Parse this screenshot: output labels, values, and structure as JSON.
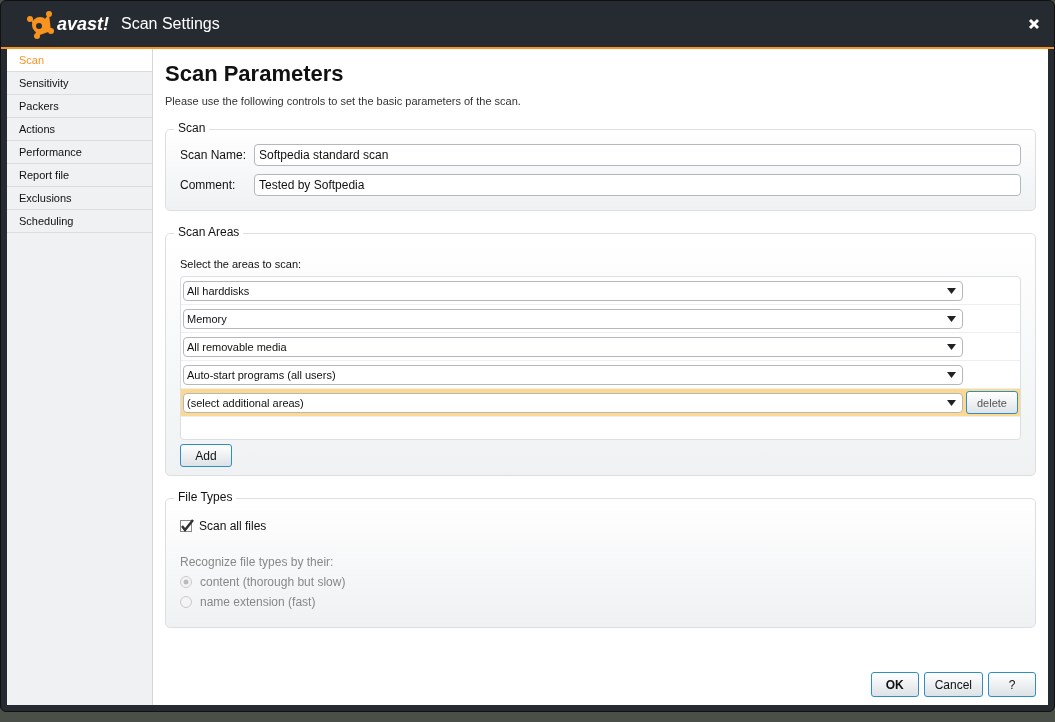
{
  "window": {
    "title": "Scan Settings",
    "logo": "avast!"
  },
  "sidebar": {
    "items": [
      {
        "label": "Scan",
        "selected": true
      },
      {
        "label": "Sensitivity",
        "selected": false
      },
      {
        "label": "Packers",
        "selected": false
      },
      {
        "label": "Actions",
        "selected": false
      },
      {
        "label": "Performance",
        "selected": false
      },
      {
        "label": "Report file",
        "selected": false
      },
      {
        "label": "Exclusions",
        "selected": false
      },
      {
        "label": "Scheduling",
        "selected": false
      }
    ]
  },
  "page": {
    "heading": "Scan Parameters",
    "description": "Please use the following controls to set the basic parameters of the scan."
  },
  "scan_group": {
    "title": "Scan",
    "fields": [
      {
        "label": "Scan Name:",
        "value": "Softpedia standard scan"
      },
      {
        "label": "Comment:",
        "value": "Tested by Softpedia"
      }
    ]
  },
  "areas_group": {
    "title": "Scan Areas",
    "prompt": "Select the areas to scan:",
    "areas": [
      {
        "value": "All harddisks",
        "selected": false
      },
      {
        "value": "Memory",
        "selected": false
      },
      {
        "value": "All removable media",
        "selected": false
      },
      {
        "value": "Auto-start programs (all users)",
        "selected": false
      },
      {
        "value": "(select additional areas)",
        "selected": true
      }
    ],
    "delete_button": "delete",
    "add_button": "Add"
  },
  "file_types": {
    "title": "File Types",
    "scan_all": {
      "label": "Scan all files",
      "checked": true
    },
    "recognize_label": "Recognize file types by their:",
    "disabled": true,
    "options": [
      {
        "label": "content (thorough but slow)",
        "selected": true
      },
      {
        "label": "name extension (fast)",
        "selected": false
      }
    ]
  },
  "buttons": [
    {
      "label": "OK",
      "default": true
    },
    {
      "label": "Cancel",
      "default": false
    },
    {
      "label": "?",
      "default": false
    }
  ]
}
